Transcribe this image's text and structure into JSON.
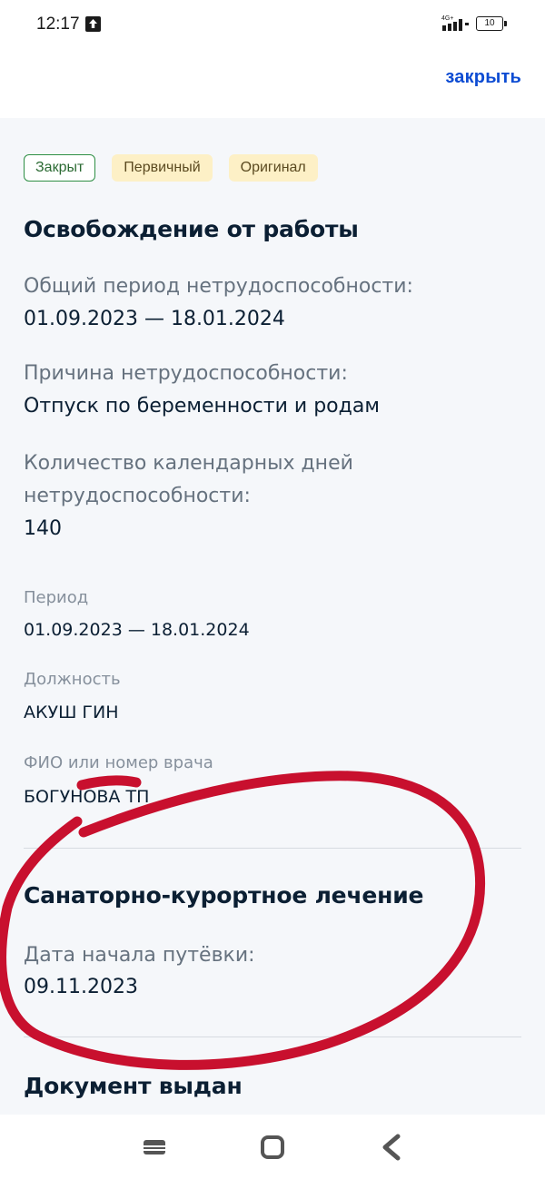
{
  "status_bar": {
    "time": "12:17",
    "network_label": "4G+",
    "battery_level": "10"
  },
  "header": {
    "close_label": "закрыть"
  },
  "badges": [
    {
      "label": "Закрыт",
      "color": "#2f8f45"
    },
    {
      "label": "Первичный",
      "color": "#fdf0c6"
    },
    {
      "label": "Оригинал",
      "color": "#fdf0c6"
    }
  ],
  "work_release": {
    "title": "Освобождение от работы",
    "total_period_label": "Общий период нетрудоспособности:",
    "total_period_value": "01.09.2023 — 18.01.2024",
    "reason_label": "Причина нетрудоспособности:",
    "reason_value": "Отпуск по беременности и родам",
    "days_label_line1": "Количество календарных дней",
    "days_label_line2": "нетрудоспособности:",
    "days_value": "140",
    "period_label": "Период",
    "period_value": "01.09.2023 — 18.01.2024",
    "position_label": "Должность",
    "position_value": "АКУШ ГИН",
    "doctor_label": "ФИО или номер врача",
    "doctor_value": "БОГУНОВА ТП"
  },
  "sanatorium": {
    "title": "Санаторно-курортное лечение",
    "start_date_label": "Дата начала путёвки:",
    "start_date_value": "09.11.2023"
  },
  "issued": {
    "title": "Документ выдан"
  },
  "colors": {
    "accent": "#0d4cd3",
    "annotation": "#c8102e",
    "content_bg": "#f5f7fa"
  }
}
